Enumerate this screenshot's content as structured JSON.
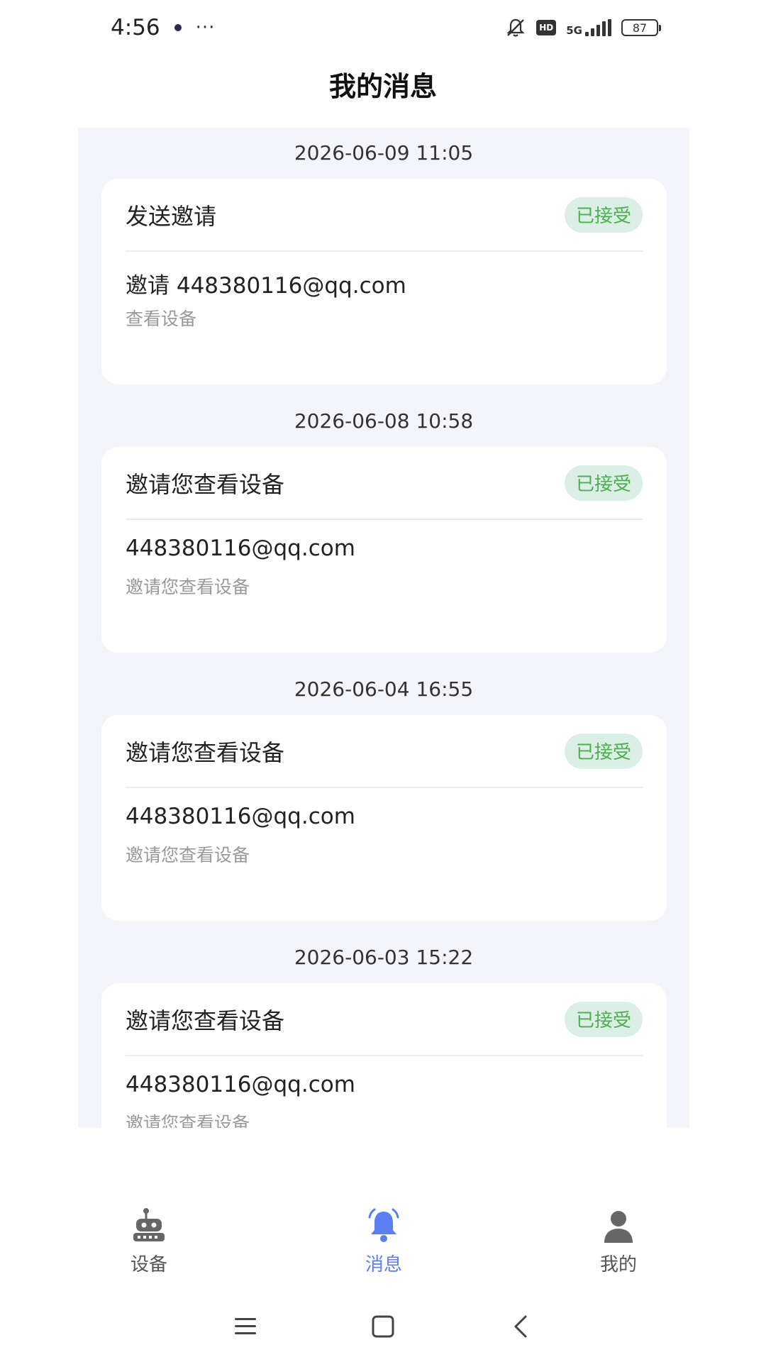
{
  "status_bar": {
    "time": "4:56",
    "more": "···",
    "network": "5G",
    "hd": "HD",
    "battery": "87"
  },
  "header": {
    "title": "我的消息"
  },
  "messages": [
    {
      "time": "2026-06-09 11:05",
      "title": "发送邀请",
      "status": "已接受",
      "main": "邀请 448380116@qq.com",
      "sub": "查看设备"
    },
    {
      "time": "2026-06-08 10:58",
      "title": "邀请您查看设备",
      "status": "已接受",
      "main": "448380116@qq.com",
      "sub": "邀请您查看设备"
    },
    {
      "time": "2026-06-04 16:55",
      "title": "邀请您查看设备",
      "status": "已接受",
      "main": "448380116@qq.com",
      "sub": "邀请您查看设备"
    },
    {
      "time": "2026-06-03 15:22",
      "title": "邀请您查看设备",
      "status": "已接受",
      "main": "448380116@qq.com",
      "sub": "邀请您查看设备"
    }
  ],
  "tabs": [
    {
      "label": "设备",
      "icon": "robot-icon"
    },
    {
      "label": "消息",
      "icon": "bell-icon",
      "active": true
    },
    {
      "label": "我的",
      "icon": "user-icon"
    }
  ],
  "colors": {
    "accent": "#5b7ff0",
    "accepted_text": "#4caf50",
    "accepted_bg": "#dcefe6",
    "list_bg": "#f4f5fa"
  }
}
